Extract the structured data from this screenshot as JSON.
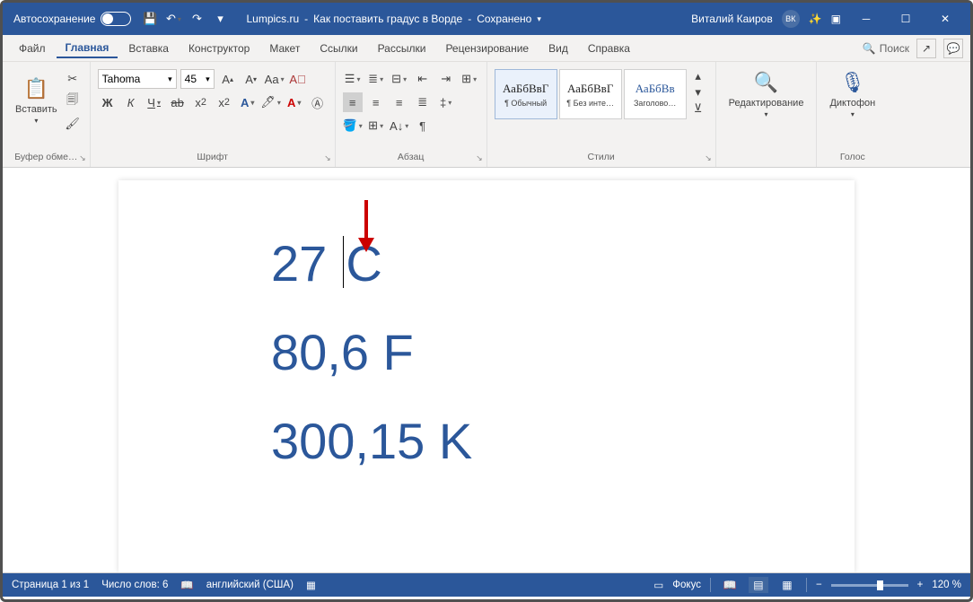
{
  "title": {
    "autosave": "Автосохранение",
    "site": "Lumpics.ru",
    "doc": "Как поставить градус в Ворде",
    "saved": "Сохранено",
    "user": "Виталий Каиров",
    "avatar": "ВК"
  },
  "menu": {
    "file": "Файл",
    "home": "Главная",
    "insert": "Вставка",
    "design": "Конструктор",
    "layout": "Макет",
    "refs": "Ссылки",
    "mail": "Рассылки",
    "review": "Рецензирование",
    "view": "Вид",
    "help": "Справка",
    "search": "Поиск"
  },
  "ribbon": {
    "clipboard": {
      "paste": "Вставить",
      "label": "Буфер обме…"
    },
    "font": {
      "name": "Tahoma",
      "size": "45",
      "label": "Шрифт",
      "bold": "Ж",
      "italic": "К",
      "under": "Ч"
    },
    "para": {
      "label": "Абзац"
    },
    "styles": {
      "label": "Стили",
      "s1": {
        "prev": "АаБбВвГ",
        "cap": "¶ Обычный"
      },
      "s2": {
        "prev": "АаБбВвГ",
        "cap": "¶ Без инте…"
      },
      "s3": {
        "prev": "АаБбВв",
        "cap": "Заголово…"
      }
    },
    "editing": {
      "label": "Редактирование"
    },
    "voice": {
      "label": "Голос",
      "btn": "Диктофон"
    }
  },
  "document": {
    "line1a": "27 ",
    "line1b": "С",
    "line2": "80,6 F",
    "line3": "300,15 K"
  },
  "status": {
    "page": "Страница 1 из 1",
    "words": "Число слов: 6",
    "lang": "английский (США)",
    "focus": "Фокус",
    "zoom": "120 %"
  }
}
